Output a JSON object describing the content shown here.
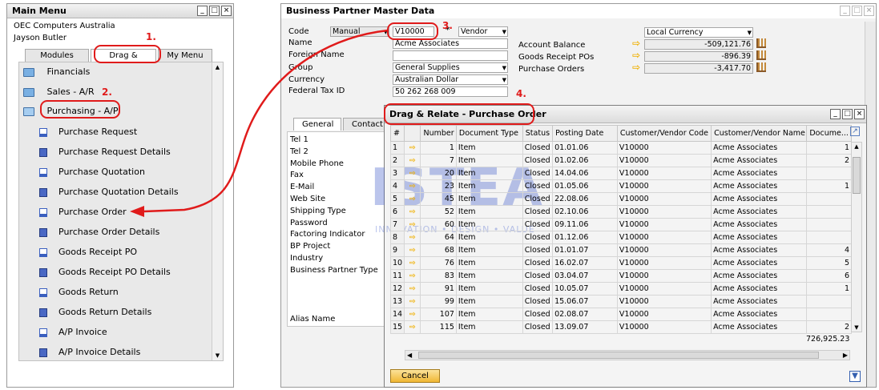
{
  "main_menu": {
    "title": "Main Menu",
    "company": "OEC Computers Australia",
    "user": "Jayson Butler",
    "tabs": [
      "Modules",
      "Drag & Relate",
      "My Menu"
    ],
    "folders": [
      "Financials",
      "Sales - A/R",
      "Purchasing - A/P"
    ],
    "items": [
      "Purchase Request",
      "Purchase Request Details",
      "Purchase Quotation",
      "Purchase Quotation Details",
      "Purchase Order",
      "Purchase Order Details",
      "Goods Receipt PO",
      "Goods Receipt PO Details",
      "Goods Return",
      "Goods Return Details",
      "A/P Invoice",
      "A/P Invoice Details"
    ]
  },
  "annotations": [
    "1.",
    "2.",
    "3.",
    "4."
  ],
  "bp": {
    "title": "Business Partner Master Data",
    "labels": [
      "Code",
      "Name",
      "Foreign Name",
      "Group",
      "Currency",
      "Federal Tax ID"
    ],
    "code_type": "Manual",
    "code": "V10000",
    "bp_type": "Vendor",
    "name": "Acme Associates",
    "foreign_name": "",
    "group": "General Supplies",
    "currency": "Australian Dollar",
    "tax_id": "50 262 268 009",
    "currency_select": "Local Currency",
    "balances": [
      {
        "label": "Account Balance",
        "value": "-509,121.76"
      },
      {
        "label": "Goods Receipt POs",
        "value": "-896.39"
      },
      {
        "label": "Purchase Orders",
        "value": "-3,417.70"
      }
    ],
    "tabs": [
      "General",
      "Contact"
    ],
    "general_fields": [
      "Tel 1",
      "Tel 2",
      "Mobile Phone",
      "Fax",
      "E-Mail",
      "Web Site",
      "Shipping Type",
      "Password",
      "Factoring Indicator",
      "BP Project",
      "Industry",
      "Business Partner Type"
    ],
    "alias_label": "Alias Name"
  },
  "dr": {
    "title": "Drag & Relate - Purchase Order",
    "columns": [
      "#",
      "",
      "Number",
      "Document Type",
      "Status",
      "Posting Date",
      "Customer/Vendor Code",
      "Customer/Vendor Name",
      "Docume..."
    ],
    "rows": [
      [
        "1",
        "1",
        "Item",
        "Closed",
        "01.01.06",
        "V10000",
        "Acme Associates",
        "1"
      ],
      [
        "2",
        "7",
        "Item",
        "Closed",
        "01.02.06",
        "V10000",
        "Acme Associates",
        "2"
      ],
      [
        "3",
        "20",
        "Item",
        "Closed",
        "14.04.06",
        "V10000",
        "Acme Associates",
        ""
      ],
      [
        "4",
        "23",
        "Item",
        "Closed",
        "01.05.06",
        "V10000",
        "Acme Associates",
        "1"
      ],
      [
        "5",
        "45",
        "Item",
        "Closed",
        "22.08.06",
        "V10000",
        "Acme Associates",
        ""
      ],
      [
        "6",
        "52",
        "Item",
        "Closed",
        "02.10.06",
        "V10000",
        "Acme Associates",
        ""
      ],
      [
        "7",
        "60",
        "Item",
        "Closed",
        "09.11.06",
        "V10000",
        "Acme Associates",
        ""
      ],
      [
        "8",
        "64",
        "Item",
        "Closed",
        "01.12.06",
        "V10000",
        "Acme Associates",
        ""
      ],
      [
        "9",
        "68",
        "Item",
        "Closed",
        "01.01.07",
        "V10000",
        "Acme Associates",
        "4"
      ],
      [
        "10",
        "76",
        "Item",
        "Closed",
        "16.02.07",
        "V10000",
        "Acme Associates",
        "5"
      ],
      [
        "11",
        "83",
        "Item",
        "Closed",
        "03.04.07",
        "V10000",
        "Acme Associates",
        "6"
      ],
      [
        "12",
        "91",
        "Item",
        "Closed",
        "10.05.07",
        "V10000",
        "Acme Associates",
        "1"
      ],
      [
        "13",
        "99",
        "Item",
        "Closed",
        "15.06.07",
        "V10000",
        "Acme Associates",
        ""
      ],
      [
        "14",
        "107",
        "Item",
        "Closed",
        "02.08.07",
        "V10000",
        "Acme Associates",
        ""
      ],
      [
        "15",
        "115",
        "Item",
        "Closed",
        "13.09.07",
        "V10000",
        "Acme Associates",
        "2"
      ]
    ],
    "total": "726,925.23",
    "cancel": "Cancel"
  },
  "watermark": {
    "main": "ISTEA",
    "sub": "INNOVATION • DESIGN • VALUE"
  },
  "colors": {
    "accent_red": "#e01b1b",
    "arrow_yellow": "#f0b000",
    "cancel_btn": "#f3c24a"
  }
}
